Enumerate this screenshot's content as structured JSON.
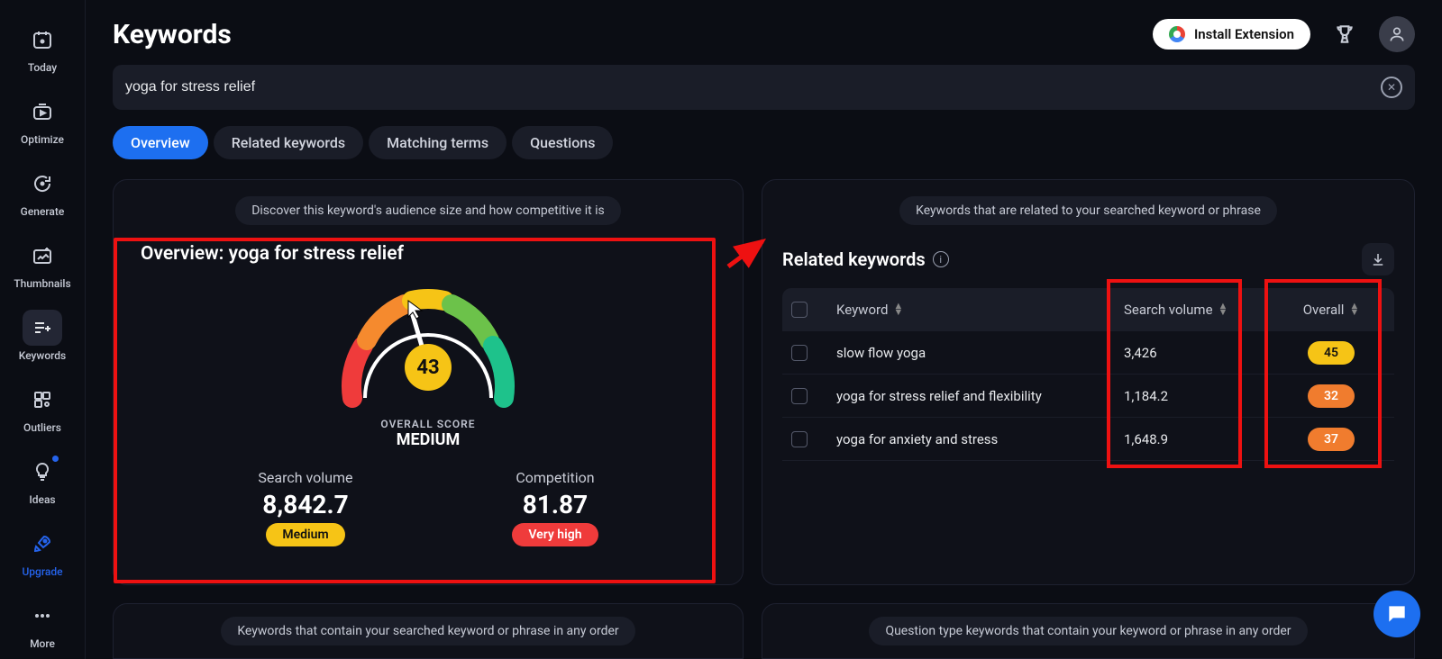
{
  "sidebar": {
    "items": [
      {
        "label": "Today",
        "icon": "calendar"
      },
      {
        "label": "Optimize",
        "icon": "video-play"
      },
      {
        "label": "Generate",
        "icon": "refresh"
      },
      {
        "label": "Thumbnails",
        "icon": "image-plus"
      },
      {
        "label": "Keywords",
        "icon": "list-plus",
        "active": true
      },
      {
        "label": "Outliers",
        "icon": "grid-dots"
      },
      {
        "label": "Ideas",
        "icon": "lightbulb",
        "dot": true
      },
      {
        "label": "Upgrade",
        "icon": "rocket",
        "upgrade": true
      },
      {
        "label": "More",
        "icon": "dots"
      }
    ]
  },
  "header": {
    "title": "Keywords",
    "install_label": "Install Extension"
  },
  "search": {
    "value": "yoga for stress relief"
  },
  "tabs": [
    {
      "label": "Overview",
      "active": true
    },
    {
      "label": "Related keywords"
    },
    {
      "label": "Matching terms"
    },
    {
      "label": "Questions"
    }
  ],
  "overview": {
    "chip": "Discover this keyword's audience size and how competitive it is",
    "title": "Overview: yoga for stress relief",
    "score": "43",
    "score_label_small": "OVERALL SCORE",
    "score_label_big": "MEDIUM",
    "metrics": {
      "sv_title": "Search volume",
      "sv_value": "8,842.7",
      "sv_badge": "Medium",
      "comp_title": "Competition",
      "comp_value": "81.87",
      "comp_badge": "Very high"
    }
  },
  "related": {
    "chip": "Keywords that are related to your searched keyword or phrase",
    "title": "Related keywords",
    "columns": {
      "kw": "Keyword",
      "sv": "Search volume",
      "ov": "Overall"
    },
    "rows": [
      {
        "kw": "slow flow yoga",
        "sv": "3,426",
        "ov": "45",
        "ov_color": "yellow"
      },
      {
        "kw": "yoga for stress relief and flexibility",
        "sv": "1,184.2",
        "ov": "32",
        "ov_color": "orange"
      },
      {
        "kw": "yoga for anxiety and stress",
        "sv": "1,648.9",
        "ov": "37",
        "ov_color": "orange"
      }
    ]
  },
  "lower": {
    "left_chip": "Keywords that contain your searched keyword or phrase in any order",
    "right_chip": "Question type keywords that contain your keyword or phrase in any order"
  }
}
